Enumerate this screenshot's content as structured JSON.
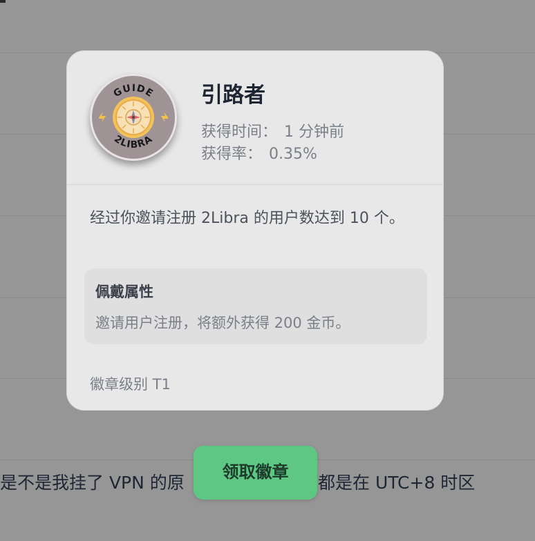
{
  "badge_popup": {
    "title": "引路者",
    "earned_time_label": "获得时间：",
    "earned_time_value": "1 分钟前",
    "earn_rate_label": "获得率：",
    "earn_rate_value": "0.35%",
    "description": "经过你邀请注册 2Libra 的用户数达到 10 个。",
    "wear_attributes": {
      "heading": "佩戴属性",
      "text": "邀请用户注册，将额外获得 200 金币。"
    },
    "level": "徽章级别 T1",
    "badge_image": {
      "top_text": "GUIDE",
      "bottom_text": "2LIBRA",
      "icon": "compass-icon"
    }
  },
  "claim_button": {
    "label": "领取徽章"
  },
  "background": {
    "text_left": "是不是我挂了 VPN 的原",
    "text_right": "都是在 UTC+8 时区"
  },
  "colors": {
    "overlay": "#969696",
    "card": "#e8e8e8",
    "accent_button": "#5ec783",
    "title": "#1f2633",
    "muted": "#7a7f88"
  }
}
